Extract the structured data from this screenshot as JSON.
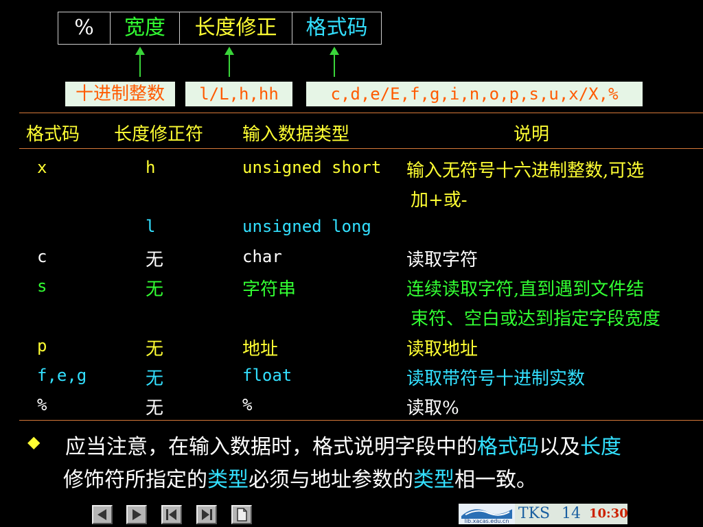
{
  "format_spec": {
    "cells": [
      "%",
      "宽度",
      "长度修正",
      "格式码"
    ]
  },
  "labels": {
    "decimal_integer": "十进制整数",
    "length_modifiers": "l/L,h,hh",
    "format_codes": "c,d,e/E,f,g,i,n,o,p,s,u,x/X,%"
  },
  "table": {
    "headers": [
      "格式码",
      "长度修正符",
      "输入数据类型",
      "说明"
    ],
    "rows": [
      {
        "code": "x",
        "modifier": "h",
        "type": "unsigned short",
        "desc": "输入无符号十六进制整数,可选",
        "desc2": "加+或-"
      },
      {
        "code": "",
        "modifier": "l",
        "type": "unsigned long",
        "desc": "",
        "desc2": ""
      },
      {
        "code": "c",
        "modifier": "无",
        "type": "char",
        "desc": "读取字符",
        "desc2": ""
      },
      {
        "code": "s",
        "modifier": "无",
        "type": "字符串",
        "desc": "连续读取字符,直到遇到文件结",
        "desc2": "束符、空白或达到指定字段宽度"
      },
      {
        "code": "p",
        "modifier": "无",
        "type": "地址",
        "desc": "读取地址",
        "desc2": ""
      },
      {
        "code": "f,e,g",
        "modifier": "无",
        "type": "float",
        "desc": "读取带符号十进制实数",
        "desc2": ""
      },
      {
        "code": "%",
        "modifier": "无",
        "type": "%",
        "desc": "读取%",
        "desc2": ""
      }
    ]
  },
  "note": {
    "bullet": "◆",
    "line1_a": "应当注意，在输入数据时，格式说明字段中的",
    "line1_b": "格式码",
    "line1_c": "以及",
    "line1_d": "长度",
    "line2_a": "修饰符所指定的",
    "line2_b": "类型",
    "line2_c": "必须与地址参数的",
    "line2_d": "类型",
    "line2_e": "相一致。"
  },
  "footer": {
    "logo_text": "lib.xacas.edu.cn",
    "tks": "TKS",
    "page": "14",
    "time": "10:30"
  },
  "colors": {
    "background": "#000000",
    "rule": "#d87a3a",
    "arrow": "#3ad53a"
  },
  "icons": [
    "prev-slide-icon",
    "next-slide-icon",
    "first-slide-icon",
    "last-slide-icon",
    "document-icon"
  ]
}
